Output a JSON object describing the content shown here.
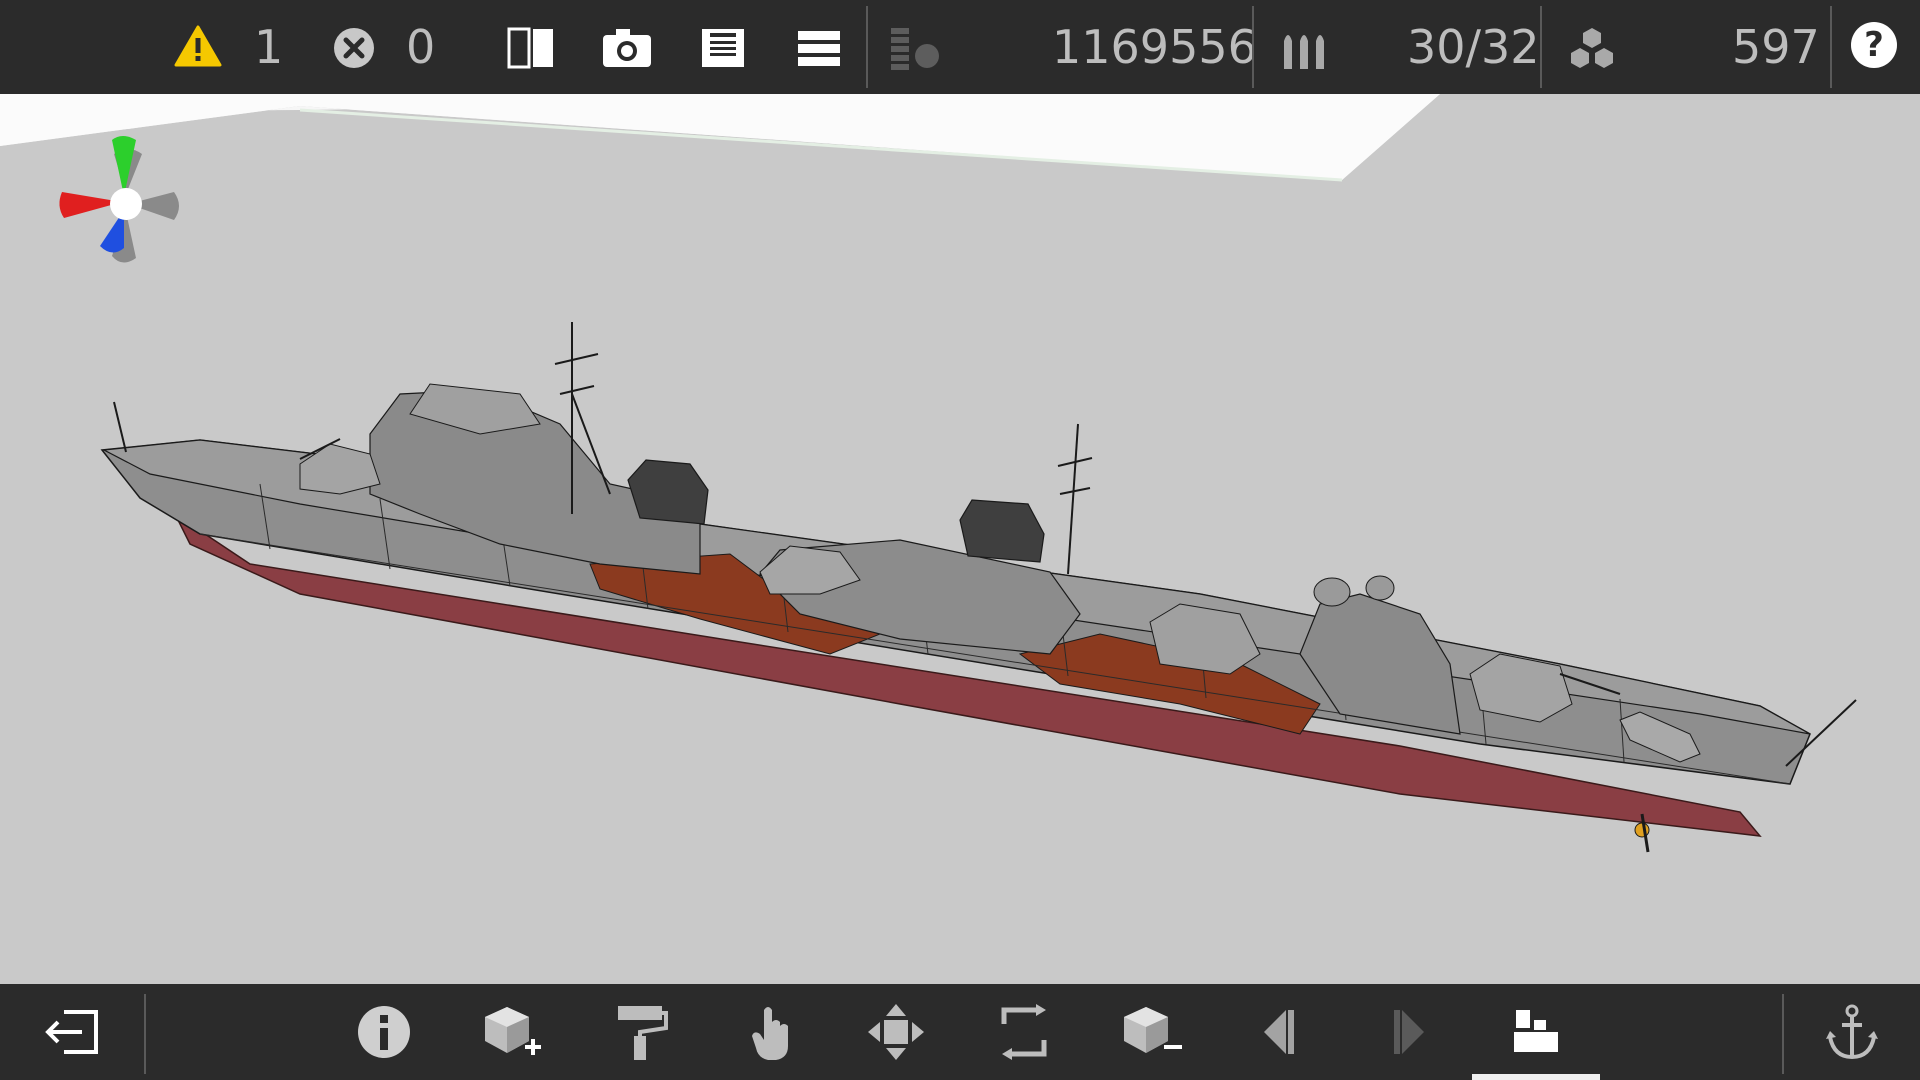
{
  "toolbar": {
    "warnings_count": "1",
    "errors_count": "0",
    "mass_value": "1169556",
    "ammo_value": "30/32",
    "parts_value": "597",
    "help_label": "?"
  },
  "colors": {
    "bar": "#2b2b2b",
    "viewport": "#c9c9c9",
    "warning": "#f5c800",
    "hull_gray": "#8e8e8e",
    "deck_wood": "#8b3a1f",
    "hull_red": "#8a3e44"
  },
  "icons": {
    "warning": "warning-triangle-icon",
    "error": "error-x-icon",
    "compare": "compare-split-icon",
    "camera": "camera-icon",
    "save": "save-icon",
    "menu": "menu-icon",
    "stability": "stability-icon",
    "ammo": "ammo-shells-icon",
    "parts": "parts-cubes-icon",
    "help": "help-icon",
    "exit": "exit-icon",
    "info": "info-icon",
    "add_part": "add-part-icon",
    "paint": "paint-roller-icon",
    "select": "hand-select-icon",
    "move": "move-arrows-icon",
    "rotate": "rotate-icon",
    "remove_part": "remove-part-icon",
    "prev": "previous-icon",
    "next": "next-icon",
    "layers": "layers-icon",
    "anchor": "anchor-icon"
  }
}
